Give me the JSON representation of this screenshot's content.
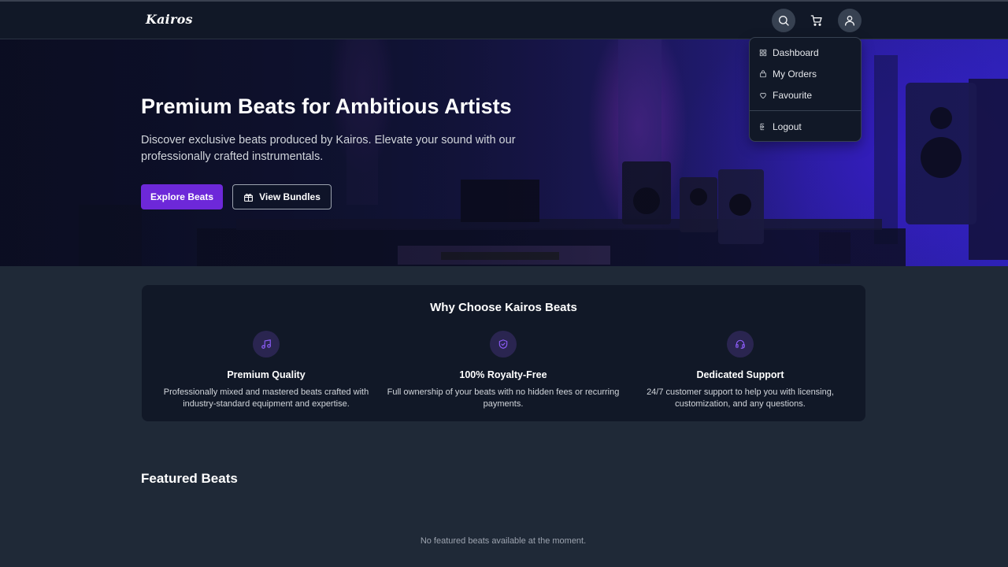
{
  "header": {
    "logo": "Kairos",
    "icons": [
      "search-icon",
      "cart-icon",
      "user-icon"
    ]
  },
  "user_menu": {
    "items": [
      {
        "label": "Dashboard",
        "icon": "dashboard-icon"
      },
      {
        "label": "My Orders",
        "icon": "bag-icon"
      },
      {
        "label": "Favourite",
        "icon": "heart-icon"
      }
    ],
    "logout": {
      "label": "Logout",
      "icon": "logout-icon"
    }
  },
  "hero": {
    "title": "Premium Beats for Ambitious Artists",
    "subtitle": "Discover exclusive beats produced by Kairos. Elevate your sound with our professionally crafted instrumentals.",
    "primary_button": "Explore Beats",
    "secondary_button": "View Bundles"
  },
  "features": {
    "title": "Why Choose Kairos Beats",
    "items": [
      {
        "title": "Premium Quality",
        "description": "Professionally mixed and mastered beats crafted with industry-standard equipment and expertise.",
        "icon": "music-note-icon"
      },
      {
        "title": "100% Royalty-Free",
        "description": "Full ownership of your beats with no hidden fees or recurring payments.",
        "icon": "shield-check-icon"
      },
      {
        "title": "Dedicated Support",
        "description": "24/7 customer support to help you with licensing, customization, and any questions.",
        "icon": "headset-icon"
      }
    ]
  },
  "featured": {
    "title": "Featured Beats",
    "empty_message": "No featured beats available at the moment."
  },
  "colors": {
    "accent": "#6d28d9",
    "background": "#1f2937",
    "card": "#111827",
    "header": "#111827"
  }
}
